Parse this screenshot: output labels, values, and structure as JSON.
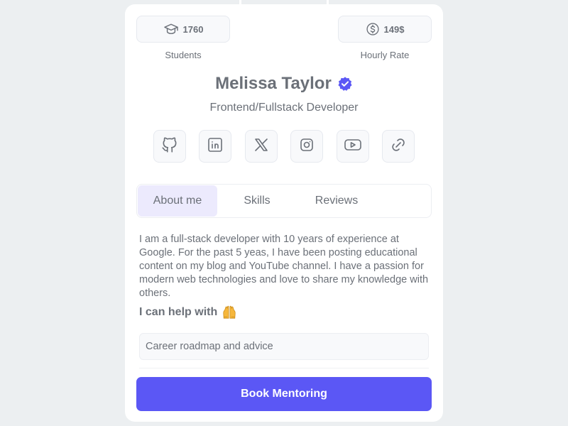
{
  "stats": {
    "students": {
      "value": "1760",
      "label": "Students",
      "icon": "graduation-cap-icon"
    },
    "rate": {
      "value": "149$",
      "label": "Hourly Rate",
      "icon": "dollar-coin-icon"
    }
  },
  "profile": {
    "name": "Melissa Taylor",
    "role": "Frontend/Fullstack Developer",
    "verified_icon": "verified-badge-icon"
  },
  "socials": [
    {
      "icon": "github-icon"
    },
    {
      "icon": "linkedin-icon"
    },
    {
      "icon": "x-icon"
    },
    {
      "icon": "instagram-icon"
    },
    {
      "icon": "youtube-icon"
    },
    {
      "icon": "link-icon"
    }
  ],
  "tabs": [
    {
      "label": "About me",
      "active": true
    },
    {
      "label": "Skills",
      "active": false
    },
    {
      "label": "Reviews",
      "active": false
    }
  ],
  "about": {
    "text": "I am a full-stack developer with 10 years of experience at Google. For the past 5 yeas, I have been posting educational content on my blog and YouTube channel. I have a passion for modern web technologies and love to share my knowledge with others."
  },
  "help": {
    "heading": "I can help with",
    "emoji_icon": "raising-hands-icon",
    "items": [
      "Career roadmap and advice"
    ]
  },
  "cta": {
    "label": "Book Mentoring"
  },
  "colors": {
    "accent": "#5b57f5",
    "verified": "#5b57f5",
    "active_tab_bg": "#eceafd",
    "text": "#6b7078"
  }
}
